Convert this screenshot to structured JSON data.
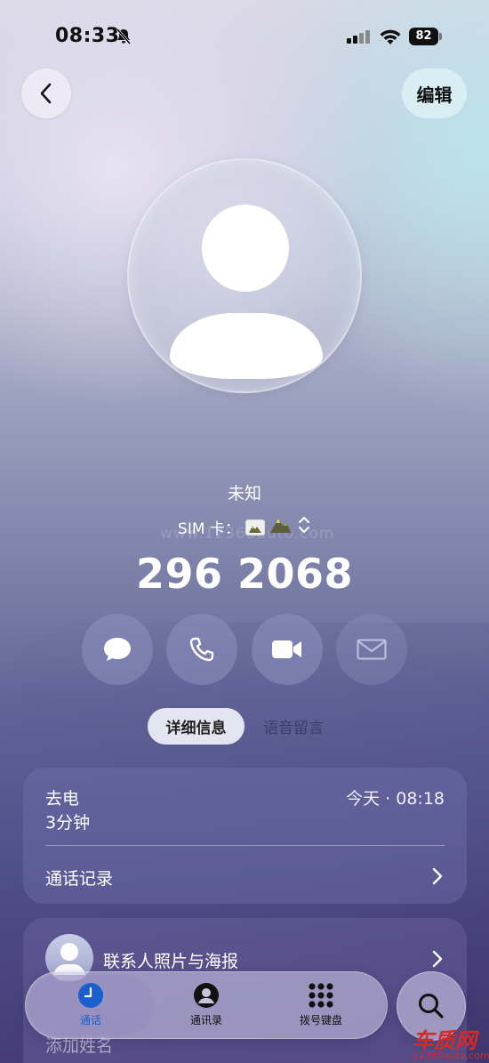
{
  "status_bar": {
    "time": "08:33",
    "battery": "82",
    "icons": [
      "bell-slash-icon",
      "signal-icon",
      "wifi-icon",
      "battery-icon"
    ]
  },
  "header": {
    "back_icon": "chevron-left-icon",
    "edit_label": "编辑"
  },
  "contact": {
    "name": "未知",
    "sim_label": "SIM 卡：",
    "number": "296 2068"
  },
  "actions": [
    {
      "name": "message",
      "icon": "message-bubble-icon"
    },
    {
      "name": "call",
      "icon": "phone-icon"
    },
    {
      "name": "video",
      "icon": "video-camera-icon"
    },
    {
      "name": "mail",
      "icon": "mail-icon"
    }
  ],
  "tabs": {
    "details": "详细信息",
    "voicemail": "语音留言"
  },
  "call_card": {
    "type": "去电",
    "duration": "3分钟",
    "time": "今天 · 08:18",
    "history_label": "通话记录"
  },
  "photo_card": {
    "label": "联系人照片与海报",
    "add_name": "添加姓名"
  },
  "bottom_nav": {
    "items": [
      {
        "label": "通话",
        "icon": "clock-icon",
        "active": true
      },
      {
        "label": "通讯录",
        "icon": "person-circle-icon",
        "active": false
      },
      {
        "label": "拨号键盘",
        "icon": "keypad-icon",
        "active": false
      }
    ],
    "search_icon": "search-icon"
  },
  "watermark": {
    "center": "www.12365auto.com",
    "logo_big": "车质网",
    "logo_small": "12365auto.com"
  },
  "colors": {
    "accent_blue": "#1a5fd0",
    "watermark_red": "#d42a2a"
  }
}
